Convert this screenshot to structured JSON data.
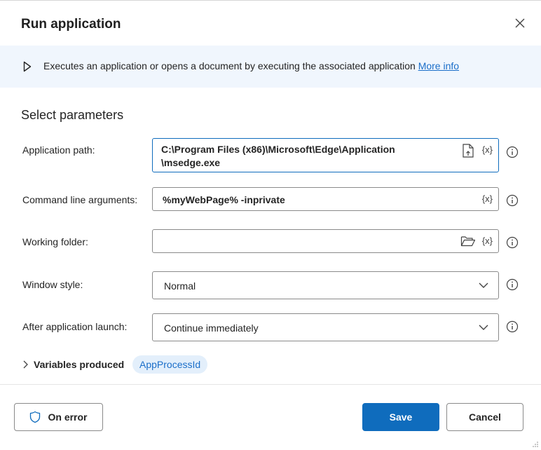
{
  "dialog": {
    "title": "Run application",
    "close_icon": "close-icon"
  },
  "banner": {
    "description": "Executes an application or opens a document by executing the associated application",
    "link_label": "More info"
  },
  "section_title": "Select parameters",
  "fields": {
    "application_path": {
      "label": "Application path:",
      "value_line1": "C:\\Program Files (x86)\\Microsoft\\Edge\\Application",
      "value_line2": "\\msedge.exe"
    },
    "command_line_arguments": {
      "label": "Command line arguments:",
      "value": "%myWebPage% -inprivate"
    },
    "working_folder": {
      "label": "Working folder:",
      "value": ""
    },
    "window_style": {
      "label": "Window style:",
      "value": "Normal"
    },
    "after_application_launch": {
      "label": "After application launch:",
      "value": "Continue immediately"
    }
  },
  "variable_button_label": "{x}",
  "variables_produced": {
    "label": "Variables produced",
    "chip": "AppProcessId"
  },
  "footer": {
    "on_error_label": "On error",
    "save_label": "Save",
    "cancel_label": "Cancel"
  },
  "colors": {
    "accent": "#0f6cbd",
    "banner_bg": "#f0f6fd",
    "chip_bg": "#e3effb",
    "link": "#1a6ec9"
  }
}
